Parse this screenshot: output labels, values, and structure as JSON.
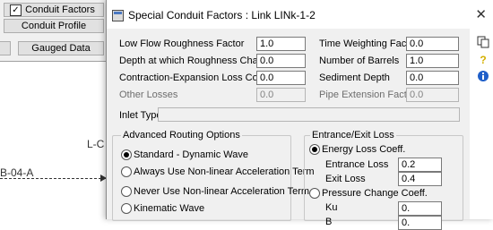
{
  "background": {
    "conduit_factors_label": "Conduit Factors",
    "conduit_profile_label": "Conduit Profile",
    "gauged_data_label": "Gauged Data",
    "node_label_partial": "L-C",
    "link_label_partial": "B-04-A"
  },
  "dialog": {
    "title": "Special Conduit Factors : Link LINk-1-2",
    "close_glyph": "✕",
    "fields": {
      "low_flow": {
        "label": "Low Flow Roughness Factor",
        "value": "1.0"
      },
      "depth_change": {
        "label": "Depth at which Roughness Changes",
        "value": "0.0"
      },
      "contraction": {
        "label": "Contraction-Expansion Loss Coeff.",
        "value": "0.0"
      },
      "other_losses": {
        "label": "Other Losses",
        "value": "0.0"
      },
      "time_weighting": {
        "label": "Time Weighting Factor",
        "value": "0.0"
      },
      "num_barrels": {
        "label": "Number of Barrels",
        "value": "1.0"
      },
      "sediment_depth": {
        "label": "Sediment Depth",
        "value": "0.0"
      },
      "pipe_extension": {
        "label": "Pipe Extension Factor",
        "value": "0.0"
      }
    },
    "inlet_type_label": "Inlet Type",
    "routing": {
      "title": "Advanced Routing Options",
      "options": [
        "Standard - Dynamic Wave",
        "Always Use Non-linear Acceleration Term",
        "Never Use Non-linear Acceleration Term",
        "Kinematic Wave"
      ],
      "selected_index": 0
    },
    "entrance_exit": {
      "title": "Entrance/Exit Loss",
      "energy_option": "Energy Loss Coeff.",
      "entrance_label": "Entrance Loss",
      "entrance_value": "0.2",
      "exit_label": "Exit Loss",
      "exit_value": "0.4",
      "pressure_option": "Pressure Change Coeff.",
      "ku_label": "Ku",
      "ku_value": "0.",
      "b_label": "B",
      "b_value": "0."
    }
  },
  "side_tools": {
    "copy_icon": "copy-icon",
    "help_icon": "help-icon",
    "info_icon": "info-icon"
  }
}
